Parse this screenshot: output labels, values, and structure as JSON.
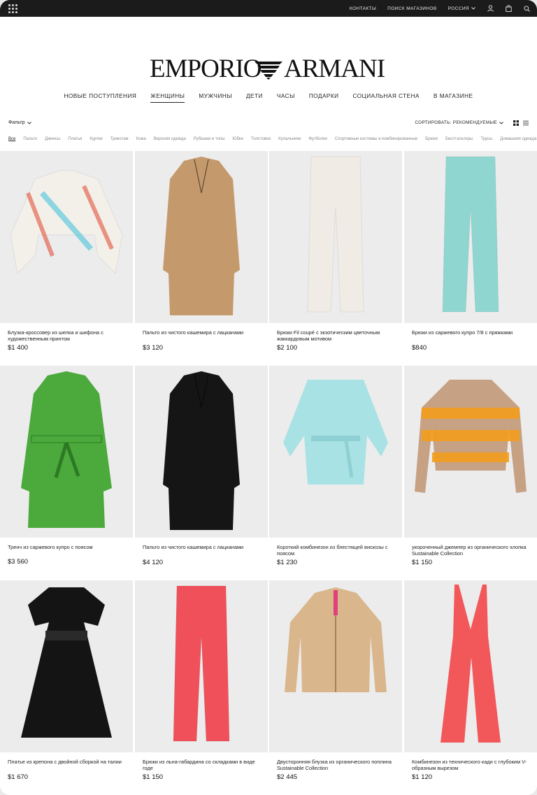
{
  "topbar": {
    "links": [
      "КОНТАКТЫ",
      "ПОИСК МАГАЗИНОВ",
      "РОССИЯ"
    ]
  },
  "brand": {
    "left": "EMPORIO",
    "right": "ARMANI"
  },
  "main_nav": [
    {
      "label": "НОВЫЕ ПОСТУПЛЕНИЯ",
      "active": false
    },
    {
      "label": "ЖЕНЩИНЫ",
      "active": true
    },
    {
      "label": "МУЖЧИНЫ",
      "active": false
    },
    {
      "label": "ДЕТИ",
      "active": false
    },
    {
      "label": "ЧАСЫ",
      "active": false
    },
    {
      "label": "ПОДАРКИ",
      "active": false
    },
    {
      "label": "СОЦИАЛЬНАЯ СТЕНА",
      "active": false
    },
    {
      "label": "В МАГАЗИНЕ",
      "active": false
    }
  ],
  "toolbar": {
    "filter_label": "Фильтр",
    "sort_label": "СОРТИРОВАТЬ: РЕКОМЕНДУЕМЫЕ"
  },
  "categories": [
    "Все",
    "Пальто",
    "Джинсы",
    "Платья",
    "Куртки",
    "Трикотаж",
    "Кожа",
    "Верхняя одежда",
    "Рубашки и топы",
    "Юбки",
    "Толстовки",
    "Купальники",
    "Футболки",
    "Спортивные костюмы и комбинированные",
    "Брюки",
    "Бюстгальтеры",
    "Трусы",
    "Домашняя одежда"
  ],
  "products": [
    {
      "name": "Блузка-кроссовер из шелка и шифона с художественным принтом",
      "price": "$1 400",
      "kind": "blouse",
      "color": "#f3f0ea"
    },
    {
      "name": "Пальто из чистого кашемира с лацканами",
      "price": "$3 120",
      "kind": "coat",
      "color": "#c49a6c"
    },
    {
      "name": "Брюки Fil coupé с экзотическим цветочным жаккардовым мотивом",
      "price": "$2 100",
      "kind": "pants",
      "color": "#f1ebe6"
    },
    {
      "name": "Брюки из саржевого купро 7/8 с пряжками",
      "price": "$840",
      "kind": "pants",
      "color": "#8fd6d0"
    },
    {
      "name": "Тренч из саржевого купро с поясом",
      "price": "$3 560",
      "kind": "trench",
      "color": "#4caa3d"
    },
    {
      "name": "Пальто из чистого кашемира с лацканами",
      "price": "$4 120",
      "kind": "coat",
      "color": "#151515"
    },
    {
      "name": "Короткий комбинезон из блестящей вискозы с поясом",
      "price": "$1 230",
      "kind": "romper",
      "color": "#a9e2e4"
    },
    {
      "name": "укороченный джемпер из органического хлопка Sustainable Collection",
      "price": "$1 150",
      "kind": "sweater",
      "color": "#c7a184"
    },
    {
      "name": "Платье из крепона с двойной сборкой на талии",
      "price": "$1 670",
      "kind": "dress",
      "color": "#141414"
    },
    {
      "name": "Брюки из льна-габардина со складками в виде годе",
      "price": "$1 150",
      "kind": "pants",
      "color": "#f0505a"
    },
    {
      "name": "Двусторонняя блузка из органического поплина Sustainable Collection",
      "price": "$2 445",
      "kind": "jacket",
      "color": "#d9b68c"
    },
    {
      "name": "Комбинезон из технического кади с глубоким V-образным вырезом",
      "price": "$1 120",
      "kind": "jumpsuit",
      "color": "#f2585a"
    }
  ],
  "icons": [
    "grid-menu-icon",
    "user-icon",
    "bag-icon",
    "search-icon",
    "chevron-down-icon",
    "grid-view-icon",
    "list-view-icon"
  ]
}
